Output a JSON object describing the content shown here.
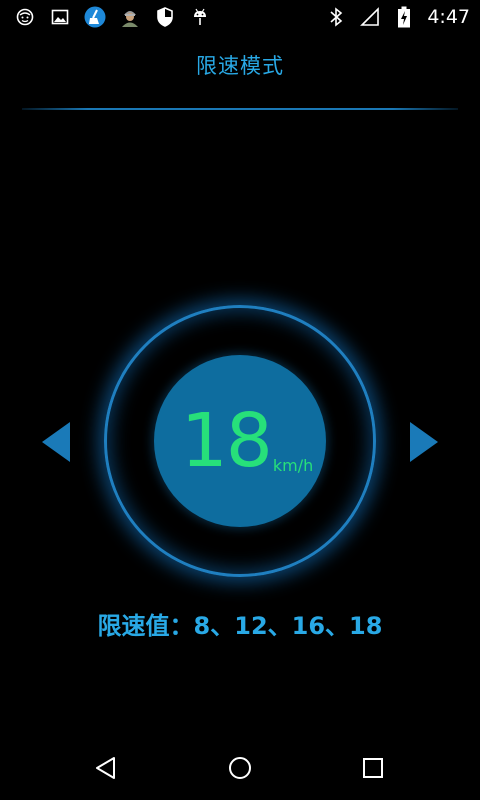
{
  "status_bar": {
    "time": "4:47",
    "icons_left": [
      "smiley-icon",
      "image-icon",
      "cleaner-app-icon",
      "avatar-icon",
      "shield-icon",
      "android-icon"
    ],
    "icons_right": [
      "bluetooth-icon",
      "signal-icon",
      "battery-charging-icon"
    ]
  },
  "header": {
    "title": "限速模式"
  },
  "dial": {
    "speed": "18",
    "unit": "km/h"
  },
  "limits": {
    "text": "限速值：8、12、16、18"
  },
  "colors": {
    "accent": "#29a9e6",
    "speed": "#27e07a",
    "dial_fill": "#0e6d9f",
    "ring": "#1f7fc0"
  },
  "nav": {
    "icons": [
      "back-icon",
      "home-icon",
      "recents-icon"
    ]
  }
}
